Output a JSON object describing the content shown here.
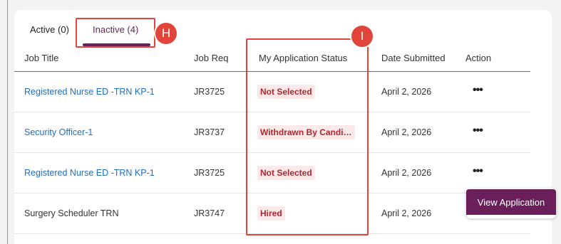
{
  "tabs": {
    "active_label": "Active (0)",
    "inactive_label": "Inactive (4)"
  },
  "annotations": {
    "h": "H",
    "i": "I"
  },
  "table": {
    "headers": {
      "job_title": "Job Title",
      "job_req": "Job Req",
      "status": "My Application Status",
      "date": "Date Submitted",
      "action": "Action"
    },
    "rows": [
      {
        "title": "Registered Nurse ED -TRN KP-1",
        "req": "JR3725",
        "status": "Not Selected",
        "date": "April 2, 2026",
        "action": "•••",
        "linked": true
      },
      {
        "title": "Security Officer-1",
        "req": "JR3737",
        "status": "Withdrawn By Candi…",
        "date": "April 2, 2026",
        "action": "•••",
        "linked": true
      },
      {
        "title": "Registered Nurse ED -TRN KP-1",
        "req": "JR3725",
        "status": "Not Selected",
        "date": "April 2, 2026",
        "action": "•••",
        "linked": true
      },
      {
        "title": "Surgery Scheduler TRN",
        "req": "JR3747",
        "status": "Hired",
        "date": "April 2, 2026",
        "action": "",
        "linked": false
      }
    ]
  },
  "popover": {
    "view_application_label": "View Application"
  },
  "colors": {
    "accent": "#6a1f5a",
    "link": "#1e6ec3",
    "status_text": "#b3262e",
    "status_bg": "#fbe8e8",
    "annotation": "#e0443a"
  }
}
